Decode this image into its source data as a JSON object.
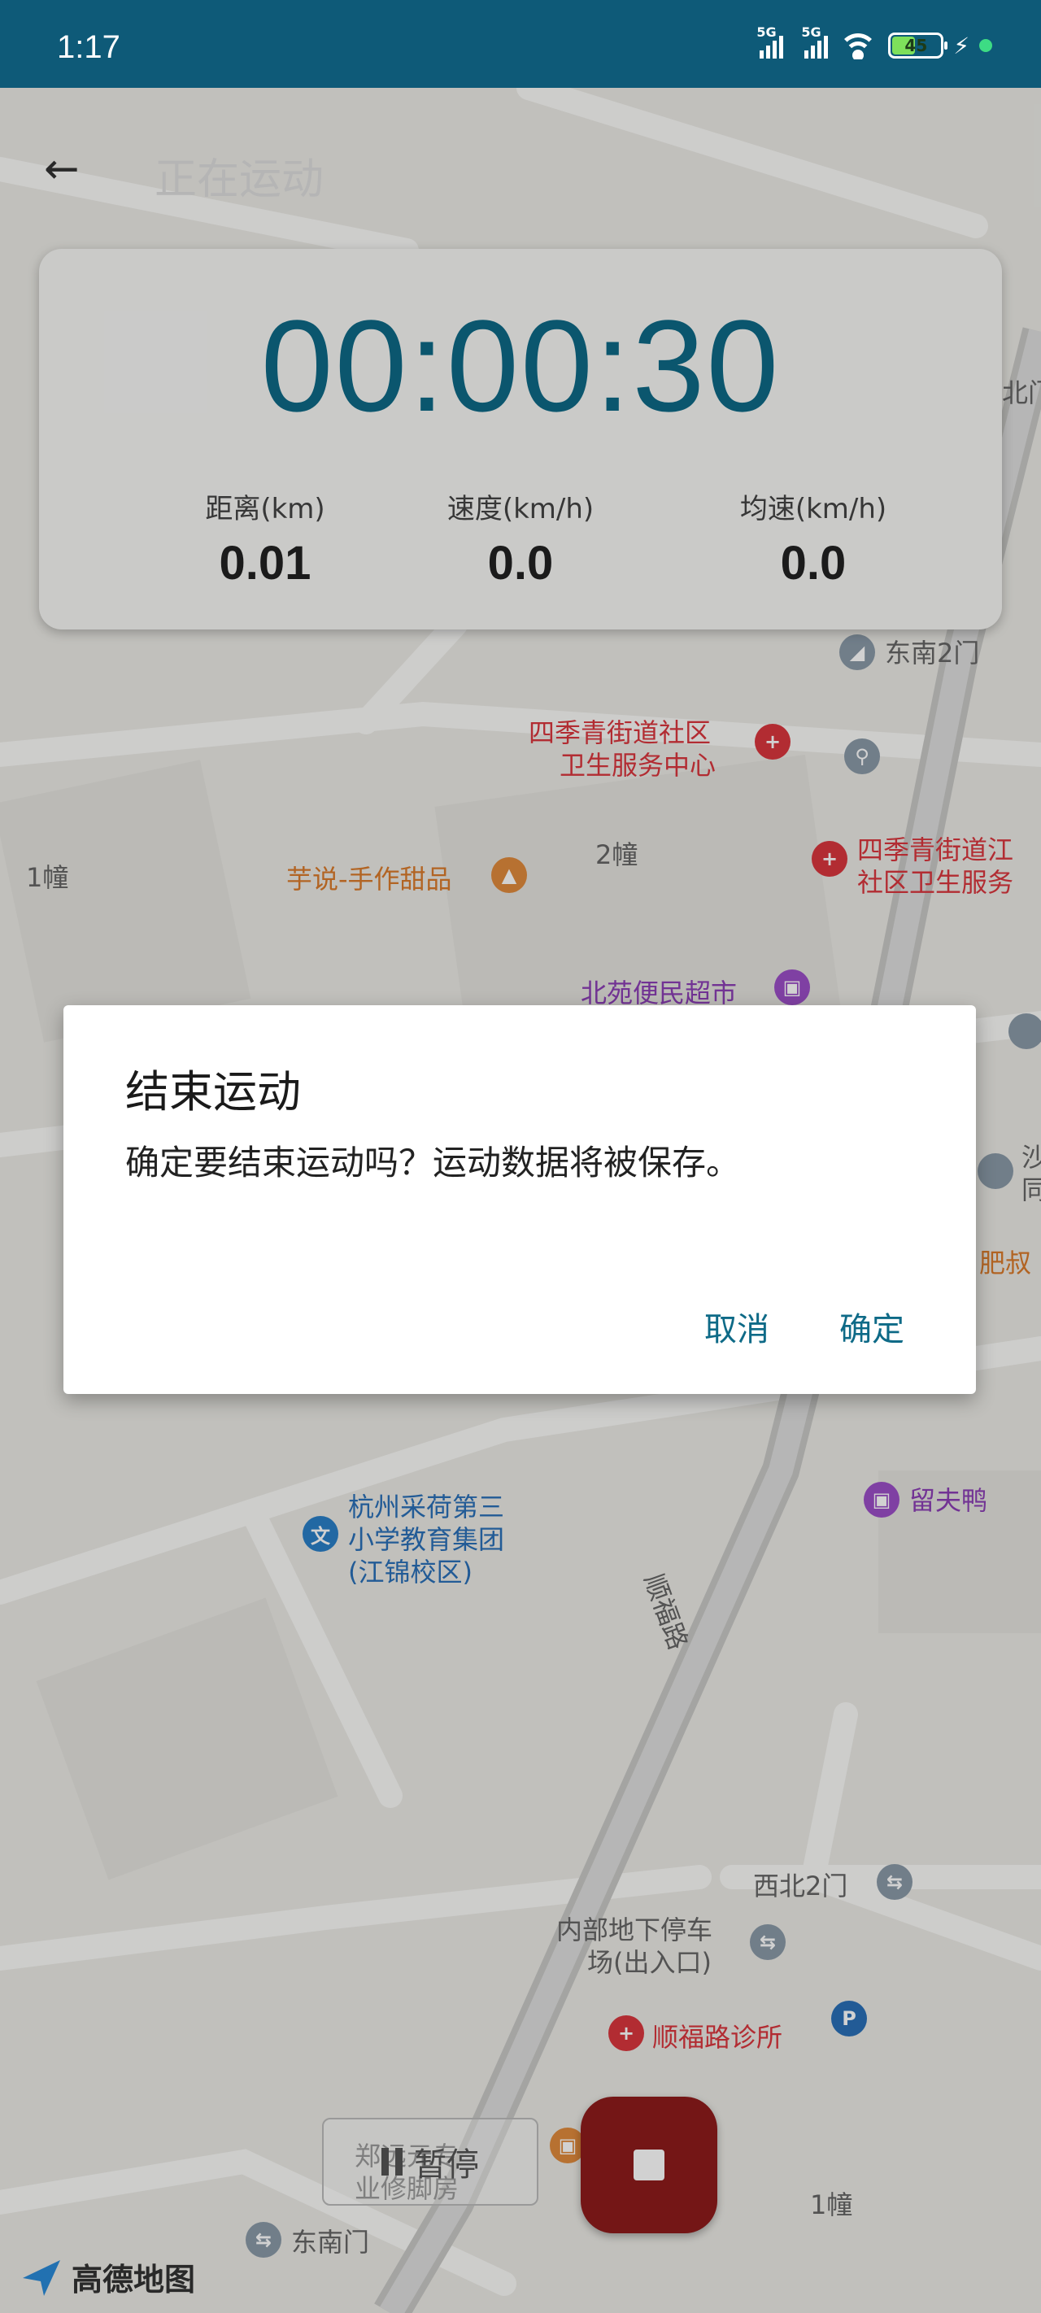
{
  "status_bar": {
    "time": "1:17",
    "network1": "5G",
    "network2": "5G",
    "battery_level": "45",
    "battery_fraction": 0.45
  },
  "header": {
    "title": "正在运动"
  },
  "stats": {
    "timer": "00:00:30",
    "items": [
      {
        "label": "距离(km)",
        "value": "0.01"
      },
      {
        "label": "速度(km/h)",
        "value": "0.0"
      },
      {
        "label": "均速(km/h)",
        "value": "0.0"
      }
    ]
  },
  "map": {
    "pois": [
      {
        "name": "东南2门"
      },
      {
        "name": "四季青街道社区"
      },
      {
        "name": "卫生服务中心"
      },
      {
        "name": "1幢"
      },
      {
        "name": "2幢"
      },
      {
        "name": "芋说-手作甜品"
      },
      {
        "name": "四季青街道江"
      },
      {
        "name": "社区卫生服务"
      },
      {
        "name": "北苑便民超市"
      },
      {
        "name": "肥叔"
      },
      {
        "name": "杭州采荷第三"
      },
      {
        "name": "小学教育集团"
      },
      {
        "name": "(江锦校区)"
      },
      {
        "name": "留夫鸭"
      },
      {
        "name": "顺福路"
      },
      {
        "name": "西北2门"
      },
      {
        "name": "内部地下停车"
      },
      {
        "name": "场(出入口)"
      },
      {
        "name": "顺福路诊所"
      },
      {
        "name": "郑远元专"
      },
      {
        "name": "业修脚房"
      },
      {
        "name": "东南门"
      },
      {
        "name": "1幢"
      },
      {
        "name": "北门"
      },
      {
        "name": "沙"
      },
      {
        "name": "同"
      }
    ],
    "logo": "高德地图"
  },
  "controls": {
    "pause_label": "暂停"
  },
  "dialog": {
    "title": "结束运动",
    "message": "确定要结束运动吗？运动数据将被保存。",
    "cancel_label": "取消",
    "confirm_label": "确定"
  },
  "colors": {
    "status_bar": "#0e5a78",
    "accent": "#0e6a87",
    "stop_button": "#8e1b1b"
  }
}
